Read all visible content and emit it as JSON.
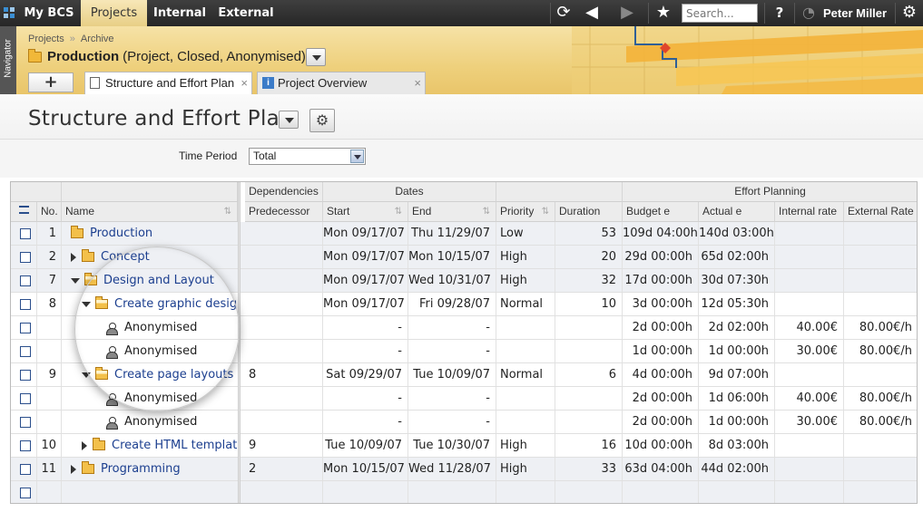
{
  "topnav": {
    "tabs": [
      {
        "label": "My BCS",
        "active": false
      },
      {
        "label": "Projects",
        "active": true
      },
      {
        "label": "Internal",
        "active": false
      },
      {
        "label": "External",
        "active": false
      }
    ],
    "search_placeholder": "Search...",
    "user": "Peter Miller",
    "help": "?",
    "icons": [
      "refresh-icon",
      "back-icon",
      "forward-icon",
      "star-icon",
      "help-icon",
      "timer-icon",
      "gear-icon"
    ]
  },
  "navigator_label": "Navigator",
  "breadcrumb": [
    "Projects",
    "Archive"
  ],
  "breadcrumb_sep": "»",
  "project": {
    "name": "Production",
    "status": "(Project, Closed, Anonymised)"
  },
  "doc_tabs": [
    {
      "label": "Structure and Effort Plan",
      "active": true,
      "icon": "document-icon"
    },
    {
      "label": "Project Overview",
      "active": false,
      "icon": "info-icon"
    }
  ],
  "add_tab_label": "+",
  "page_title": "Structure and Effort Plan",
  "filter": {
    "label": "Time Period",
    "value": "Total"
  },
  "grid": {
    "group_headers": {
      "dependencies": "Dependencies",
      "dates": "Dates",
      "effort_planning": "Effort Planning"
    },
    "columns": {
      "no": "No.",
      "name": "Name",
      "predecessor": "Predecessor",
      "start": "Start",
      "end": "End",
      "priority": "Priority",
      "duration": "Duration",
      "budget": "Budget e",
      "actual": "Actual e",
      "internal_rate": "Internal rate",
      "external_rate": "External Rate"
    },
    "rows": [
      {
        "no": "1",
        "name": "Production",
        "level": 0,
        "kind": "folder",
        "expander": "none",
        "pred": "",
        "start": "Mon 09/17/07",
        "end": "Thu 11/29/07",
        "priority": "Low",
        "duration": "53",
        "budget": "109d 04:00h",
        "actual": "140d 03:00h",
        "irate": "",
        "erate": "",
        "shaded": true
      },
      {
        "no": "2",
        "name": "Concept",
        "level": 1,
        "kind": "folder",
        "expander": "collapsed",
        "pred": "",
        "start": "Mon 09/17/07",
        "end": "Mon 10/15/07",
        "priority": "High",
        "duration": "20",
        "budget": "29d 00:00h",
        "actual": "65d 02:00h",
        "irate": "",
        "erate": "",
        "shaded": true
      },
      {
        "no": "7",
        "name": "Design and Layout",
        "level": 1,
        "kind": "folder",
        "expander": "expanded",
        "pred": "",
        "start": "Mon 09/17/07",
        "end": "Wed 10/31/07",
        "priority": "High",
        "duration": "32",
        "budget": "17d 00:00h",
        "actual": "30d 07:30h",
        "irate": "",
        "erate": "",
        "shaded": true
      },
      {
        "no": "8",
        "name": "Create graphic design",
        "level": 2,
        "kind": "folder",
        "expander": "expanded",
        "pred": "",
        "start": "Mon 09/17/07",
        "end": "Fri 09/28/07",
        "priority": "Normal",
        "duration": "10",
        "budget": "3d 00:00h",
        "actual": "12d 05:30h",
        "irate": "",
        "erate": "",
        "shaded": false
      },
      {
        "no": "",
        "name": "Anonymised",
        "level": 3,
        "kind": "person",
        "expander": "none",
        "pred": "",
        "start": "-",
        "end": "-",
        "priority": "",
        "duration": "",
        "budget": "2d 00:00h",
        "actual": "2d 02:00h",
        "irate": "40.00€",
        "erate": "80.00€/h",
        "shaded": false
      },
      {
        "no": "",
        "name": "Anonymised",
        "level": 3,
        "kind": "person",
        "expander": "none",
        "pred": "",
        "start": "-",
        "end": "-",
        "priority": "",
        "duration": "",
        "budget": "1d 00:00h",
        "actual": "1d 00:00h",
        "irate": "30.00€",
        "erate": "80.00€/h",
        "shaded": false
      },
      {
        "no": "9",
        "name": "Create page layouts",
        "level": 2,
        "kind": "folder",
        "expander": "expanded",
        "pred": "8",
        "start": "Sat 09/29/07",
        "end": "Tue 10/09/07",
        "priority": "Normal",
        "duration": "6",
        "budget": "4d 00:00h",
        "actual": "9d 07:00h",
        "irate": "",
        "erate": "",
        "shaded": false
      },
      {
        "no": "",
        "name": "Anonymised",
        "level": 3,
        "kind": "person",
        "expander": "none",
        "pred": "",
        "start": "-",
        "end": "-",
        "priority": "",
        "duration": "",
        "budget": "2d 00:00h",
        "actual": "1d 06:00h",
        "irate": "40.00€",
        "erate": "80.00€/h",
        "shaded": false
      },
      {
        "no": "",
        "name": "Anonymised",
        "level": 3,
        "kind": "person",
        "expander": "none",
        "pred": "",
        "start": "-",
        "end": "-",
        "priority": "",
        "duration": "",
        "budget": "2d 00:00h",
        "actual": "1d 00:00h",
        "irate": "30.00€",
        "erate": "80.00€/h",
        "shaded": false
      },
      {
        "no": "10",
        "name": "Create HTML template",
        "level": 2,
        "kind": "folder",
        "expander": "collapsed",
        "pred": "9",
        "start": "Tue 10/09/07",
        "end": "Tue 10/30/07",
        "priority": "High",
        "duration": "16",
        "budget": "10d 00:00h",
        "actual": "8d 03:00h",
        "irate": "",
        "erate": "",
        "shaded": false
      },
      {
        "no": "11",
        "name": "Programming",
        "level": 1,
        "kind": "folder",
        "expander": "collapsed",
        "pred": "2",
        "start": "Mon 10/15/07",
        "end": "Wed 11/28/07",
        "priority": "High",
        "duration": "33",
        "budget": "63d 04:00h",
        "actual": "44d 02:00h",
        "irate": "",
        "erate": "",
        "shaded": true
      },
      {
        "no": "",
        "name": "",
        "level": 0,
        "kind": "empty",
        "expander": "none",
        "pred": "",
        "start": "",
        "end": "",
        "priority": "",
        "duration": "",
        "budget": "",
        "actual": "",
        "irate": "",
        "erate": "",
        "shaded": true
      }
    ]
  },
  "colors": {
    "header_bar": "#2d2d2d",
    "accent_gold": "#efd17f",
    "link": "#1c3f8f"
  }
}
